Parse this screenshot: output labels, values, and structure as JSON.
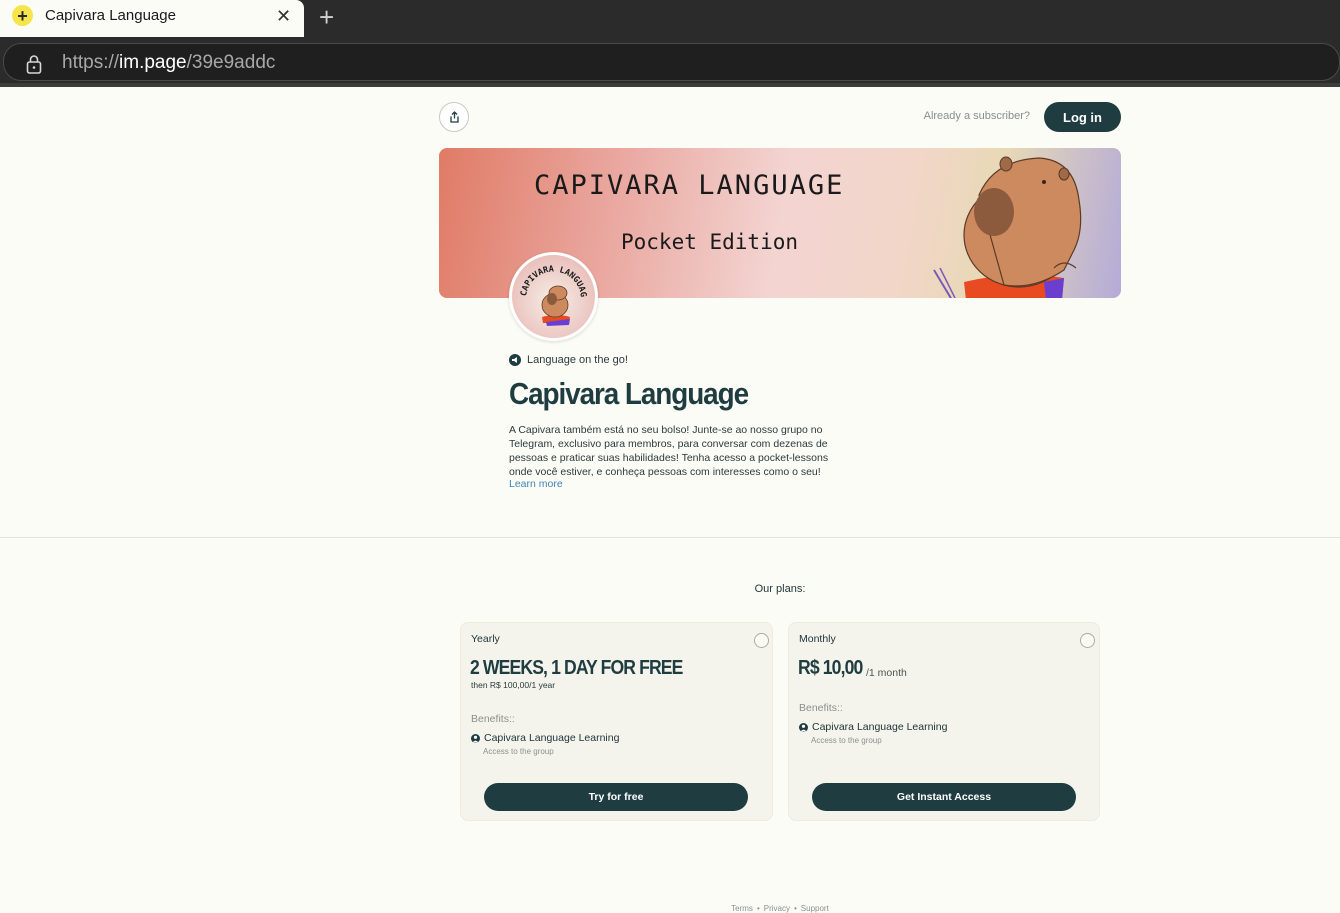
{
  "browser": {
    "tab_title": "Capivara Language",
    "url_scheme": "https://",
    "url_host": "im.page",
    "url_path": "/39e9addc"
  },
  "header": {
    "already_text": "Already a subscriber?",
    "login_label": "Log in"
  },
  "banner": {
    "title": "CAPIVARA LANGUAGE",
    "subtitle": "Pocket Edition",
    "avatar_text": "CAPIVARA LANGUAGE"
  },
  "intro": {
    "tagline": "Language on the go!",
    "title": "Capivara Language",
    "description": "A Capivara também está no seu bolso! Junte-se ao nosso grupo no Telegram, exclusivo para membros, para conversar com dezenas de pessoas e praticar suas habilidades! Tenha acesso a pocket-lessons onde você estiver, e conheça pessoas com interesses como o seu!",
    "learn_more": "Learn more"
  },
  "plans": {
    "heading": "Our plans:",
    "items": [
      {
        "name": "Yearly",
        "price": "2 WEEKS, 1 DAY FOR FREE",
        "then": "then R$ 100,00/1 year",
        "benefits_label": "Benefits::",
        "benefit_title": "Capivara Language Learning",
        "benefit_desc": "Access to the group",
        "button": "Try for free"
      },
      {
        "name": "Monthly",
        "price": "R$ 10,00",
        "price_suffix": "/1 month",
        "benefits_label": "Benefits::",
        "benefit_title": "Capivara Language Learning",
        "benefit_desc": "Access to the group",
        "button": "Get Instant Access"
      }
    ]
  },
  "footer": {
    "terms": "Terms",
    "privacy": "Privacy",
    "support": "Support",
    "separator": "•"
  },
  "colors": {
    "primary": "#1f3d41",
    "background": "#fcfcf6",
    "card": "#f4f4ec",
    "link": "#3c86b8"
  }
}
